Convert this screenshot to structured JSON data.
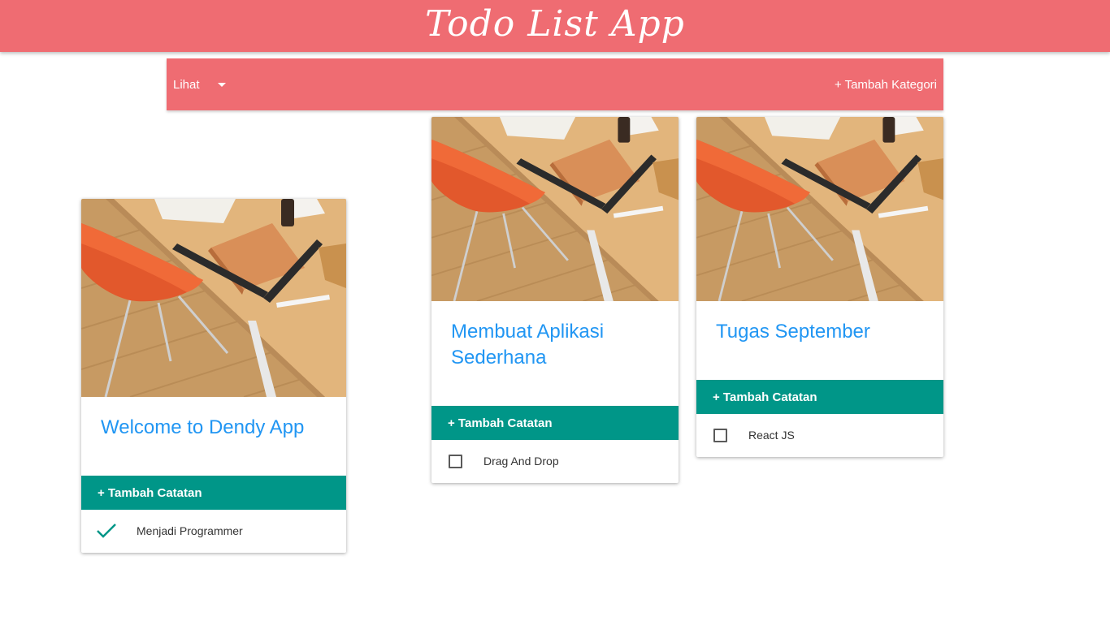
{
  "header": {
    "title": "Todo List App",
    "bg_color": "#ef6c72"
  },
  "toolbar": {
    "view_label": "Lihat",
    "add_category_label": "+ Tambah Kategori"
  },
  "cards": [
    {
      "title": "Welcome to Dendy App",
      "add_note_label": "+ Tambah Catatan",
      "notes": [
        {
          "text": "Menjadi Programmer",
          "done": true
        }
      ]
    },
    {
      "title": "Membuat Aplikasi Sederhana",
      "add_note_label": "+ Tambah Catatan",
      "notes": [
        {
          "text": "Drag And Drop",
          "done": false
        }
      ]
    },
    {
      "title": "Tugas September",
      "add_note_label": "+ Tambah Catatan",
      "notes": [
        {
          "text": "React JS",
          "done": false
        }
      ]
    }
  ],
  "colors": {
    "accent": "#009688",
    "title": "#2196f3"
  }
}
